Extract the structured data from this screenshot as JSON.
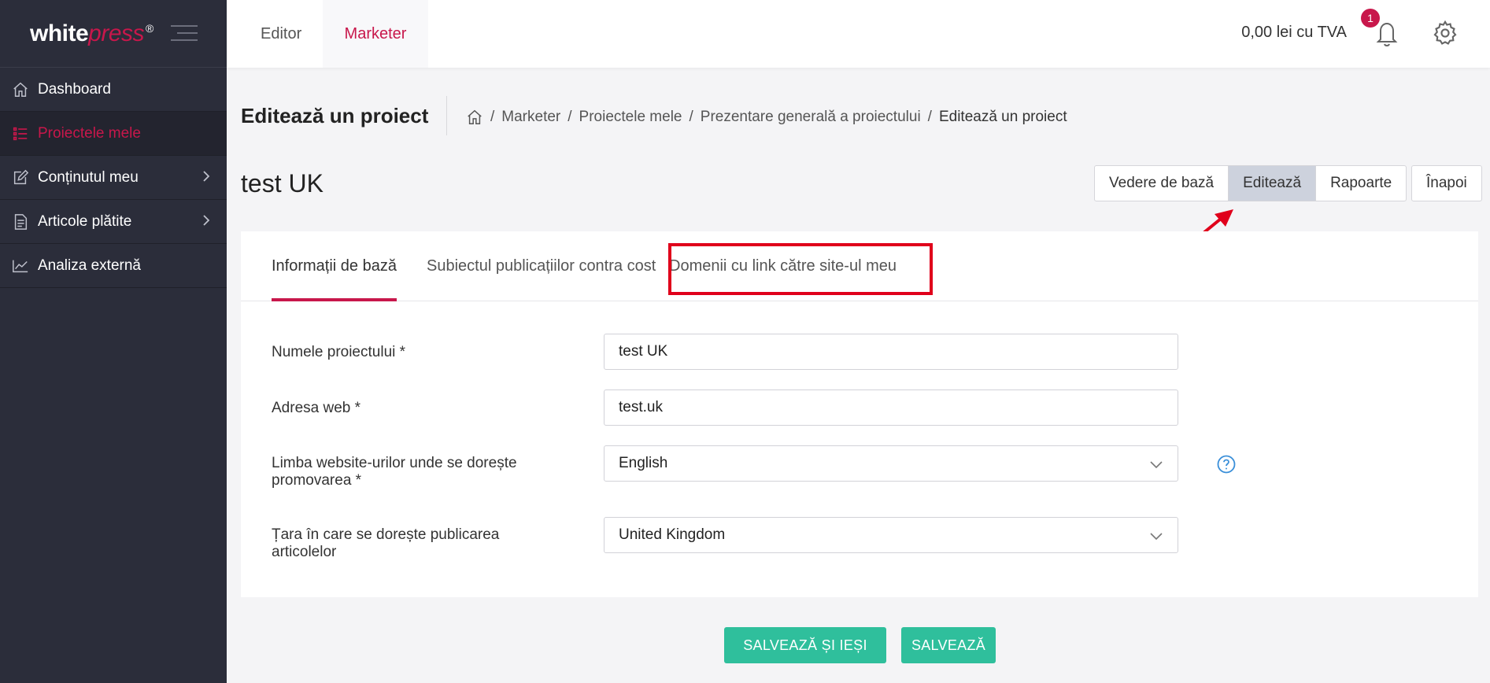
{
  "brand": {
    "logo_main": "white",
    "logo_accent": "press",
    "logo_reg": "®"
  },
  "sidebar": {
    "items": [
      {
        "label": "Dashboard"
      },
      {
        "label": "Proiectele mele"
      },
      {
        "label": "Conținutul meu"
      },
      {
        "label": "Articole plătite"
      },
      {
        "label": "Analiza externă"
      }
    ]
  },
  "topbar": {
    "tabs": [
      {
        "label": "Editor"
      },
      {
        "label": "Marketer"
      }
    ],
    "balance": "0,00 lei cu TVA",
    "notifications": "1"
  },
  "header": {
    "title": "Editează un proiect",
    "breadcrumb": [
      "Marketer",
      "Proiectele mele",
      "Prezentare generală a proiectului",
      "Editează un proiect"
    ],
    "separator": "/"
  },
  "project": {
    "name": "test UK",
    "views": [
      "Vedere de bază",
      "Editează",
      "Rapoarte"
    ],
    "back": "Înapoi"
  },
  "tabs": [
    "Informații de bază",
    "Subiectul publicațiilor contra cost",
    "Domenii cu link către site-ul meu"
  ],
  "form": {
    "name_label": "Numele proiectului *",
    "name_value": "test UK",
    "web_label": "Adresa web *",
    "web_value": "test.uk",
    "lang_label": "Limba website-urilor unde se dorește promovarea *",
    "lang_value": "English",
    "country_label": "Țara în care se dorește publicarea articolelor",
    "country_value": "United Kingdom"
  },
  "actions": {
    "save_exit": "SALVEAZĂ ȘI IEȘI",
    "save": "SALVEAZĂ"
  },
  "colors": {
    "accent": "#c8174b",
    "sidebar": "#2b2d3a",
    "primary_button": "#2fbf9c",
    "highlight": "#e0001b"
  }
}
